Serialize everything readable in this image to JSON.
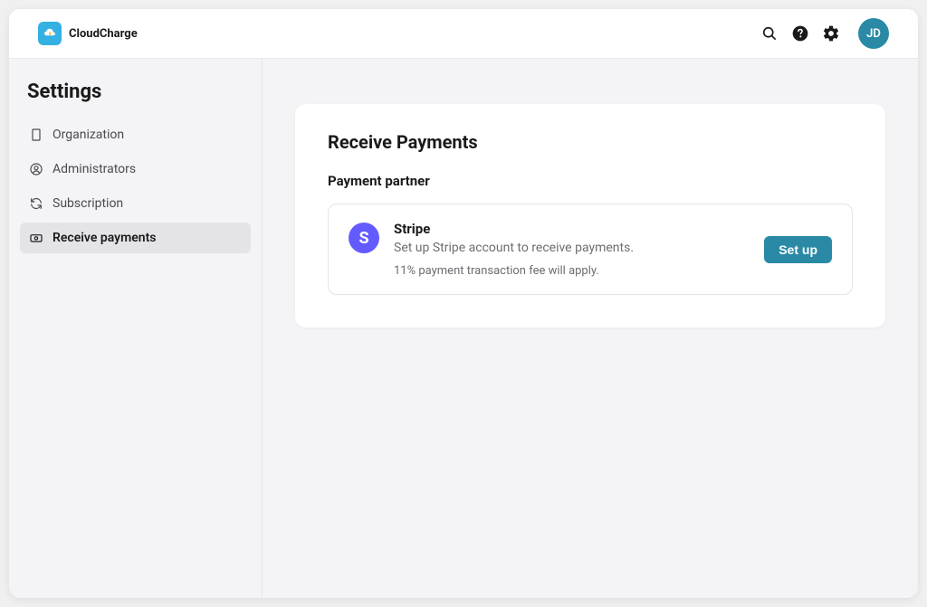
{
  "brand": {
    "name": "CloudCharge"
  },
  "avatar": {
    "initials": "JD"
  },
  "sidebar": {
    "title": "Settings",
    "items": [
      {
        "label": "Organization"
      },
      {
        "label": "Administrators"
      },
      {
        "label": "Subscription"
      },
      {
        "label": "Receive payments"
      }
    ]
  },
  "main": {
    "title": "Receive Payments",
    "section_title": "Payment partner",
    "partner": {
      "logo_letter": "S",
      "name": "Stripe",
      "description": "Set up Stripe account to receive payments.",
      "note": "11% payment transaction fee will apply.",
      "setup_label": "Set up"
    }
  }
}
